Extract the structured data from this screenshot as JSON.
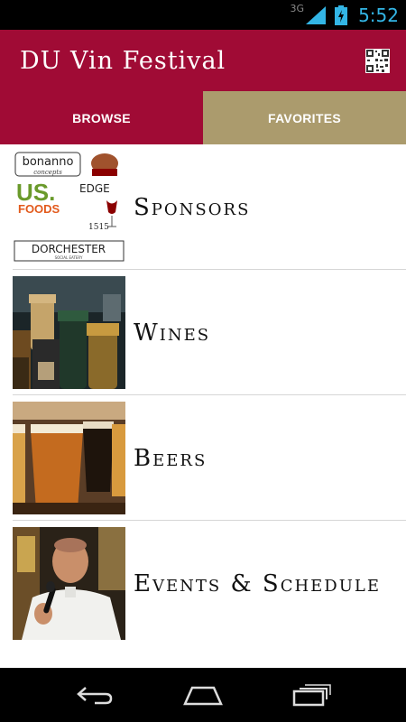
{
  "status_bar": {
    "network": "3G",
    "time": "5:52",
    "colors": {
      "accent": "#33b5e5"
    }
  },
  "header": {
    "title": "DU Vin Festival",
    "qr_icon": "qr-code-icon",
    "colors": {
      "background": "#a00b35"
    }
  },
  "tabs": [
    {
      "label": "BROWSE",
      "selected": true,
      "color": "#a00b35"
    },
    {
      "label": "FAVORITES",
      "selected": false,
      "color": "#ab9b6d"
    }
  ],
  "menu": {
    "items": [
      {
        "label": "Sponsors",
        "thumbnail": "sponsor-logos-collage"
      },
      {
        "label": "Wines",
        "thumbnail": "wine-bottles-photo"
      },
      {
        "label": "Beers",
        "thumbnail": "beer-glasses-photo"
      },
      {
        "label": "Events & Schedule",
        "thumbnail": "chef-with-microphone-photo"
      }
    ]
  },
  "sponsors": {
    "logos": [
      "bonanno",
      "concepts",
      "US.",
      "FOODS",
      "EDGE",
      "1515",
      "DORCHESTER",
      "SOCIAL EATERY"
    ]
  },
  "nav_bar": {
    "buttons": [
      "back-icon",
      "home-icon",
      "recent-apps-icon"
    ]
  }
}
